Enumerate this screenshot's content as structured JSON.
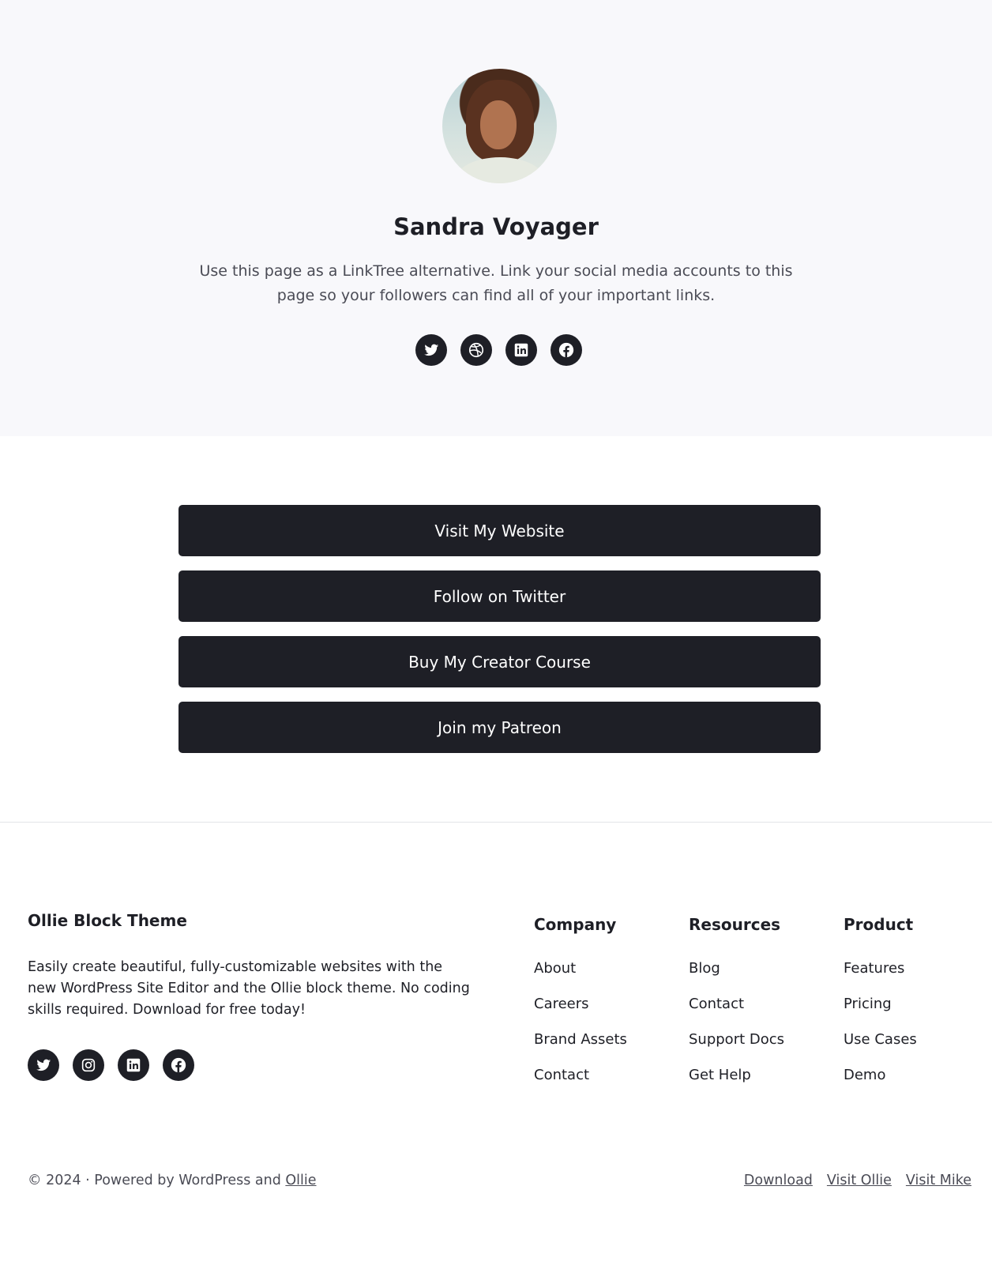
{
  "profile": {
    "name": "Sandra Voyager",
    "bio": "Use this page as a LinkTree alternative. Link your social media accounts to this page so your followers can find all of your important links.",
    "social_icons": [
      "twitter-icon",
      "dribbble-icon",
      "linkedin-icon",
      "facebook-icon"
    ]
  },
  "links": [
    {
      "label": "Visit My Website"
    },
    {
      "label": "Follow on Twitter"
    },
    {
      "label": "Buy My Creator Course"
    },
    {
      "label": "Join my Patreon"
    }
  ],
  "footer": {
    "brand": "Ollie Block Theme",
    "description": "Easily create beautiful, fully-customizable websites with the new WordPress Site Editor and the Ollie block theme. No coding skills required. Download for free today!",
    "social_icons": [
      "twitter-icon",
      "instagram-icon",
      "linkedin-icon",
      "facebook-icon"
    ],
    "columns": [
      {
        "title": "Company",
        "items": [
          "About",
          "Careers",
          "Brand Assets",
          "Contact"
        ]
      },
      {
        "title": "Resources",
        "items": [
          "Blog",
          "Contact",
          "Support Docs",
          "Get Help"
        ]
      },
      {
        "title": "Product",
        "items": [
          "Features",
          "Pricing",
          "Use Cases",
          "Demo"
        ]
      }
    ],
    "copyright_prefix": "© 2024 · Powered by WordPress and ",
    "copyright_link": "Ollie",
    "bottom_links": [
      "Download",
      "Visit Ollie",
      "Visit Mike"
    ]
  },
  "colors": {
    "hero_bg": "#f8f8fb",
    "button_bg": "#1e1f26",
    "text": "#1e1f26",
    "muted_text": "#4a4b55"
  }
}
